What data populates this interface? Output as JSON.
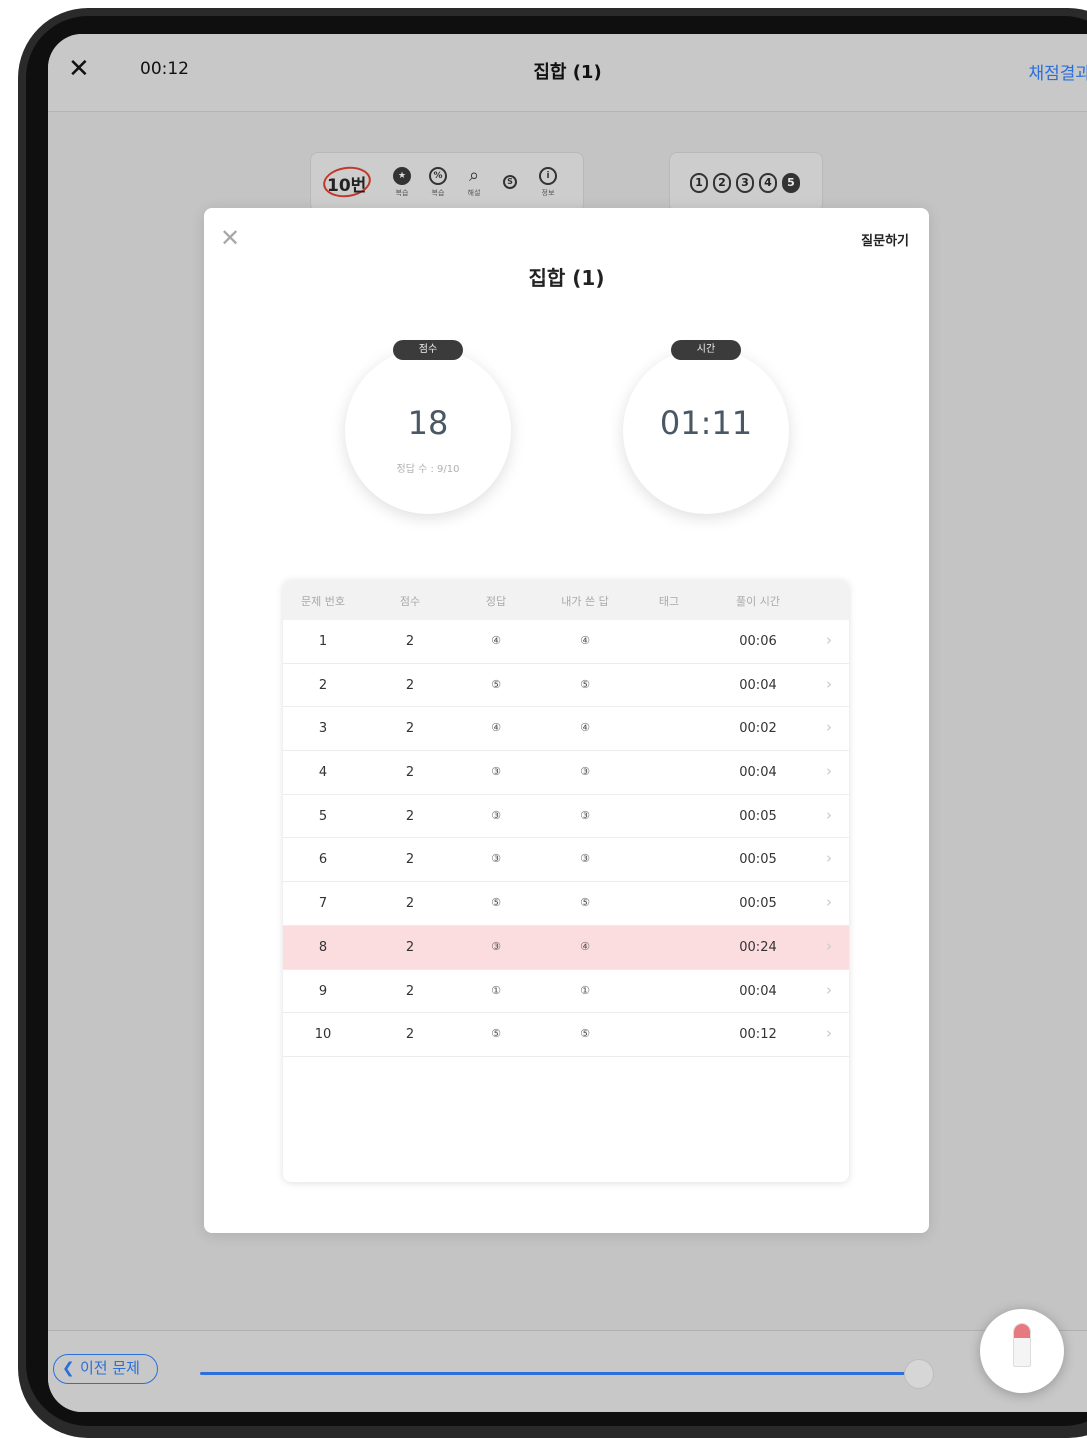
{
  "topbar": {
    "close_icon": "close-icon",
    "timer": "00:12",
    "title": "집합 (1)",
    "grade_link": "채점결과"
  },
  "toolbar": {
    "question_number": "10번",
    "tools": [
      {
        "icon": "star-icon",
        "label": "복습"
      },
      {
        "icon": "review-icon",
        "label": "복습"
      },
      {
        "icon": "search-icon",
        "label": "해설"
      },
      {
        "icon": "s-icon",
        "label": ""
      },
      {
        "icon": "info-icon",
        "label": "정보"
      }
    ],
    "options": [
      "1",
      "2",
      "3",
      "4",
      "5"
    ],
    "selected_option": "5"
  },
  "modal": {
    "title": "집합 (1)",
    "ask_button": "질문하기",
    "score_pill": "점수",
    "score_value": "18",
    "correct_count": "정답 수 : 9/10",
    "time_pill": "시간",
    "time_value": "01:11"
  },
  "table": {
    "headers": [
      "문제 번호",
      "점수",
      "정답",
      "내가 쓴 답",
      "태그",
      "풀이 시간"
    ],
    "rows": [
      {
        "num": "1",
        "score": "2",
        "answer": "④",
        "mine": "④",
        "tag": "",
        "time": "00:06",
        "wrong": false
      },
      {
        "num": "2",
        "score": "2",
        "answer": "⑤",
        "mine": "⑤",
        "tag": "",
        "time": "00:04",
        "wrong": false
      },
      {
        "num": "3",
        "score": "2",
        "answer": "④",
        "mine": "④",
        "tag": "",
        "time": "00:02",
        "wrong": false
      },
      {
        "num": "4",
        "score": "2",
        "answer": "③",
        "mine": "③",
        "tag": "",
        "time": "00:04",
        "wrong": false
      },
      {
        "num": "5",
        "score": "2",
        "answer": "③",
        "mine": "③",
        "tag": "",
        "time": "00:05",
        "wrong": false
      },
      {
        "num": "6",
        "score": "2",
        "answer": "③",
        "mine": "③",
        "tag": "",
        "time": "00:05",
        "wrong": false
      },
      {
        "num": "7",
        "score": "2",
        "answer": "⑤",
        "mine": "⑤",
        "tag": "",
        "time": "00:05",
        "wrong": false
      },
      {
        "num": "8",
        "score": "2",
        "answer": "③",
        "mine": "④",
        "tag": "",
        "time": "00:24",
        "wrong": true
      },
      {
        "num": "9",
        "score": "2",
        "answer": "①",
        "mine": "①",
        "tag": "",
        "time": "00:04",
        "wrong": false
      },
      {
        "num": "10",
        "score": "2",
        "answer": "⑤",
        "mine": "⑤",
        "tag": "",
        "time": "00:12",
        "wrong": false
      }
    ]
  },
  "bottombar": {
    "prev_button": "이전 문제",
    "slider_value": 1.0
  },
  "colors": {
    "accent": "#2a6fdb",
    "wrong_row": "#fbdde0",
    "pencil_tip": "#e67a80"
  }
}
